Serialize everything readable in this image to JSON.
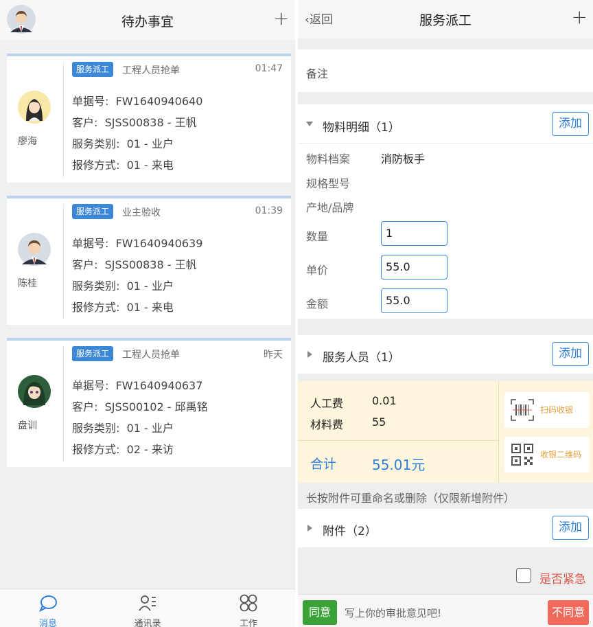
{
  "left": {
    "header": {
      "title": "待办事宜",
      "plus": "+"
    },
    "cards": [
      {
        "tag": "服务派工",
        "subtitle": "工程人员抢单",
        "time": "01:47",
        "name": "廖海",
        "doc_label": "单据号:",
        "doc_no": "FW1640940640",
        "customer_label": "客户:",
        "customer": "SJSS00838 - 王帆",
        "type_label": "服务类别:",
        "type": "01 - 业户",
        "method_label": "报修方式:",
        "method": "01 - 来电"
      },
      {
        "tag": "服务派工",
        "subtitle": "业主验收",
        "time": "01:39",
        "name": "陈桂",
        "doc_label": "单据号:",
        "doc_no": "FW1640940639",
        "customer_label": "客户:",
        "customer": "SJSS00838 - 王帆",
        "type_label": "服务类别:",
        "type": "01 - 业户",
        "method_label": "报修方式:",
        "method": "01 - 来电"
      },
      {
        "tag": "服务派工",
        "subtitle": "工程人员抢单",
        "time": "昨天",
        "name": "盘训",
        "doc_label": "单据号:",
        "doc_no": "FW1640940637",
        "customer_label": "客户:",
        "customer": "SJSS00102 - 邱禹铭",
        "type_label": "服务类别:",
        "type": "01 - 业户",
        "method_label": "报修方式:",
        "method": "02 - 来访"
      }
    ],
    "tabs": [
      {
        "label": "消息",
        "icon": "chat-bubble-icon",
        "active": true
      },
      {
        "label": "通讯录",
        "icon": "contacts-icon",
        "active": false
      },
      {
        "label": "工作",
        "icon": "four-circles-icon",
        "active": false
      }
    ]
  },
  "right": {
    "header": {
      "back": "返回",
      "title": "服务派工",
      "plus": "+"
    },
    "remark_label": "备注",
    "materials": {
      "title": "物料明细（1）",
      "add": "添加",
      "archive_label": "物料档案",
      "archive_value": "消防板手",
      "spec_label": "规格型号",
      "brand_label": "产地/品牌",
      "qty_label": "数量",
      "qty_value": "1",
      "price_label": "单价",
      "price_value": "55.0",
      "amount_label": "金额",
      "amount_value": "55.0"
    },
    "staff": {
      "title": "服务人员（1）",
      "add": "添加"
    },
    "fees": {
      "labor_label": "人工费",
      "labor_value": "0.01",
      "material_label": "材料费",
      "material_value": "55",
      "total_label": "合计",
      "total_value": "55.01元",
      "scan_pay": "扫码收银",
      "qr_pay": "收银二维码"
    },
    "attach_hint": "长按附件可重命名或删除（仅限新增附件）",
    "attachments": {
      "title": "附件（2）",
      "add": "添加"
    },
    "urgent_label": "是否紧急",
    "footer": {
      "agree": "同意",
      "placeholder": "写上你的审批意见吧!",
      "disagree": "不同意"
    }
  },
  "colors": {
    "accent": "#2f7fd8",
    "tag": "#3c87d6",
    "agree": "#3aa239",
    "disagree": "#f06a5c",
    "urgent": "#e05a4e",
    "fee_bg": "#fdf5dc"
  }
}
